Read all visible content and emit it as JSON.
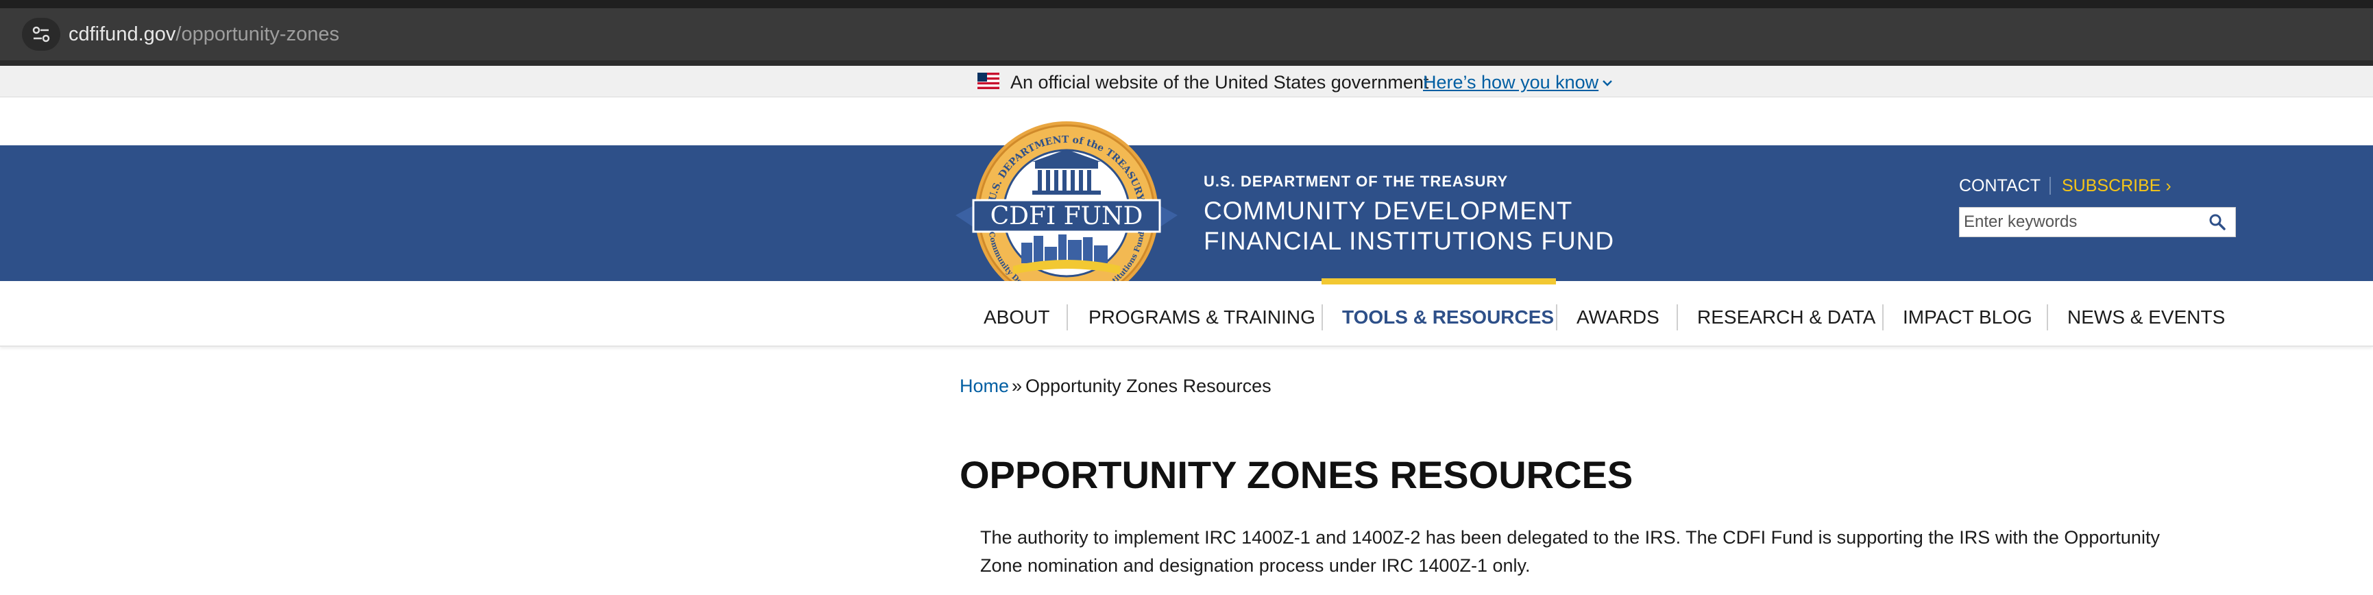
{
  "browser": {
    "url_domain": "cdfifund.gov",
    "url_path": "/opportunity-zones",
    "site_info_icon": "tune-icon"
  },
  "gov_banner": {
    "text": "An official website of the United States government",
    "link": "Here’s how you know",
    "flag_icon": "us-flag-icon"
  },
  "header": {
    "logo": {
      "arc_top": "U.S. DEPARTMENT of the TREASURY",
      "ribbon": "CDFI FUND",
      "arc_bottom": "Community Development Financial Institutions Fund"
    },
    "department": "U.S. DEPARTMENT OF THE TREASURY",
    "fund_line1": "COMMUNITY DEVELOPMENT",
    "fund_line2": "FINANCIAL INSTITUTIONS FUND",
    "contact": "CONTACT",
    "subscribe": "SUBSCRIBE ›",
    "search_placeholder": "Enter keywords"
  },
  "nav": {
    "items": [
      {
        "label": "ABOUT"
      },
      {
        "label": "PROGRAMS & TRAINING"
      },
      {
        "label": "TOOLS & RESOURCES",
        "active": true
      },
      {
        "label": "AWARDS"
      },
      {
        "label": "RESEARCH & DATA"
      },
      {
        "label": "IMPACT BLOG"
      },
      {
        "label": "NEWS & EVENTS"
      }
    ]
  },
  "breadcrumb": {
    "home": "Home",
    "separator": "»",
    "current": "Opportunity Zones Resources"
  },
  "main": {
    "title": "OPPORTUNITY ZONES RESOURCES",
    "paragraph": "The authority to implement IRC 1400Z-1 and 1400Z-2 has been delegated to the IRS. The CDFI Fund is supporting the IRS with the Opportunity Zone nomination and designation process under IRC 1400Z-1 only."
  },
  "colors": {
    "header_blue": "#2e5089",
    "accent_gold": "#f2c832",
    "link_blue": "#005ea2",
    "subscribe_yellow": "#f5c518"
  }
}
